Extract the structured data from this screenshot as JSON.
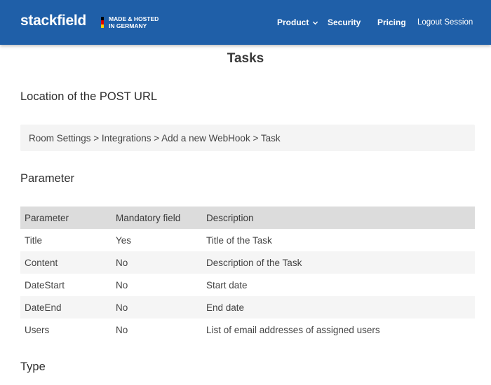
{
  "header": {
    "logo": "stackfield",
    "tagline_line1": "MADE & HOSTED",
    "tagline_line2": "IN GERMANY",
    "flag_colors": [
      "#000000",
      "#dd0000",
      "#ffce00"
    ],
    "brand_color": "#1f5fa8",
    "nav": {
      "product": "Product",
      "security": "Security",
      "pricing": "Pricing",
      "logout": "Logout Session"
    },
    "product_icon": "chevron-down-icon"
  },
  "page": {
    "title": "Tasks",
    "location_heading": "Location of the POST URL",
    "location_path": "Room Settings > Integrations > Add a new WebHook > Task",
    "parameter_heading": "Parameter",
    "type_heading": "Type"
  },
  "table": {
    "columns": [
      "Parameter",
      "Mandatory field",
      "Description"
    ],
    "rows": [
      [
        "Title",
        "Yes",
        "Title of the Task"
      ],
      [
        "Content",
        "No",
        "Description of the Task"
      ],
      [
        "DateStart",
        "No",
        "Start date"
      ],
      [
        "DateEnd",
        "No",
        "End date"
      ],
      [
        "Users",
        "No",
        "List of email addresses of assigned users"
      ]
    ]
  }
}
